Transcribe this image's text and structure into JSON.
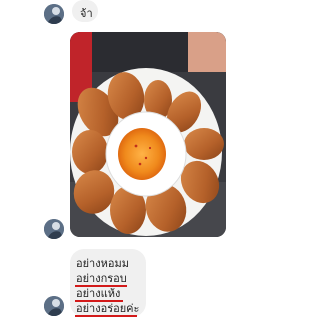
{
  "chat": {
    "message_1": {
      "text": "จ้า"
    },
    "photo_message": {
      "alt": "chicken-wings-photo"
    },
    "message_2": {
      "lines": [
        "อย่างหอมม",
        "อย่างกรอบ",
        "อย่างแห้ง",
        "อย่างอร่อยค่ะ"
      ],
      "underline_color": "#d31a1a"
    }
  },
  "colors": {
    "bubble_bg": "#f0f0f0",
    "page_bg": "#ffffff"
  }
}
